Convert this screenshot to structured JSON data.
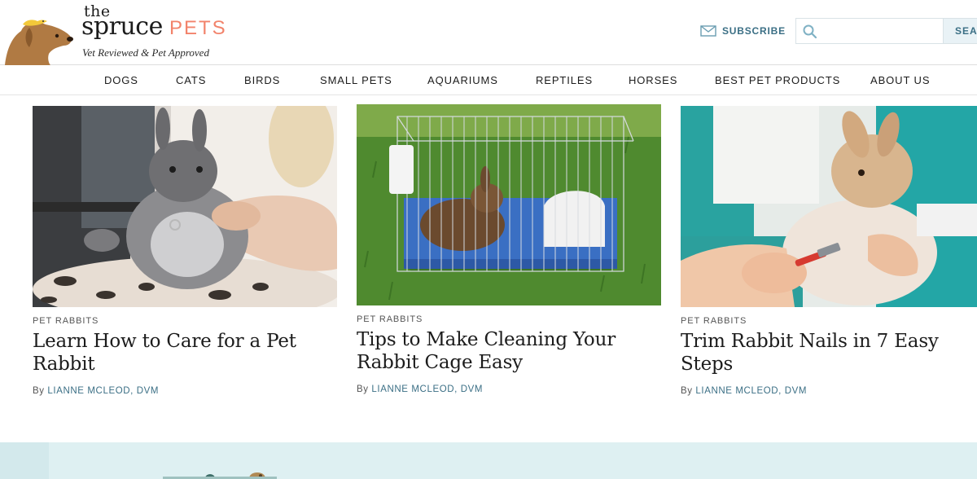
{
  "logo": {
    "the": "the",
    "spruce": "spruce",
    "pets": "PETS",
    "tagline": "Vet Reviewed & Pet Approved"
  },
  "header": {
    "subscribe_label": "SUBSCRIBE",
    "search_placeholder": "",
    "search_button_label": "SEAR"
  },
  "nav": {
    "items": [
      {
        "label": "DOGS"
      },
      {
        "label": "CATS"
      },
      {
        "label": "BIRDS"
      },
      {
        "label": "SMALL PETS"
      },
      {
        "label": "AQUARIUMS"
      },
      {
        "label": "REPTILES"
      },
      {
        "label": "HORSES"
      },
      {
        "label": "BEST PET PRODUCTS"
      },
      {
        "label": "ABOUT US"
      }
    ]
  },
  "cards": [
    {
      "tag": "PET RABBITS",
      "title": "Learn How to Care for a Pet Rabbit",
      "by": "By",
      "author": "LIANNE MCLEOD, DVM",
      "image": "rabbit held on its back by a woman"
    },
    {
      "tag": "PET RABBITS",
      "title": "Tips to Make Cleaning Your Rabbit Cage Easy",
      "by": "By",
      "author": "LIANNE MCLEOD, DVM",
      "image": "rabbit in a wire cage on grass"
    },
    {
      "tag": "PET RABBITS",
      "title": "Trim Rabbit Nails in 7 Easy Steps",
      "by": "By",
      "author": "LIANNE MCLEOD, DVM",
      "image": "vet trimming a rabbit's nails"
    }
  ],
  "colors": {
    "brand_pets": "#f2836b",
    "link_blue": "#3b6f85",
    "bottom_band": "#def0f2"
  }
}
